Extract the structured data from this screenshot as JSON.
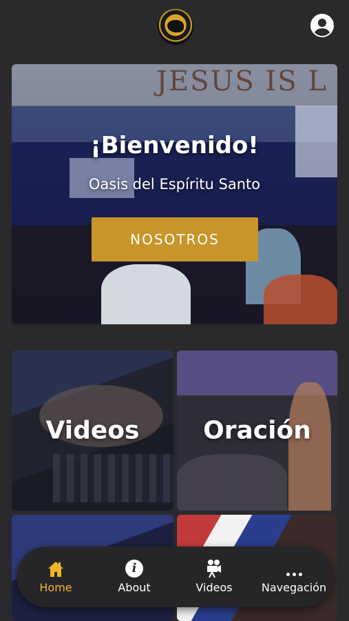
{
  "header": {
    "logo_icon": "church-logo-icon",
    "profile_icon": "user-circle-icon"
  },
  "hero": {
    "background_text": "JESUS IS L",
    "title": "¡Bienvenido!",
    "subtitle": "Oasis del Espíritu Santo",
    "cta_label": "NOSOTROS",
    "cta_color": "#c8952a"
  },
  "tiles": {
    "videos_label": "Videos",
    "oracion_label": "Oración"
  },
  "bottom_nav": {
    "items": [
      {
        "label": "Home",
        "icon": "home-icon",
        "active": true
      },
      {
        "label": "About",
        "icon": "info-icon",
        "active": false
      },
      {
        "label": "Videos",
        "icon": "video-camera-icon",
        "active": false
      },
      {
        "label": "Navegación",
        "icon": "more-dots-icon",
        "active": false
      }
    ],
    "active_color": "#f0b429"
  }
}
